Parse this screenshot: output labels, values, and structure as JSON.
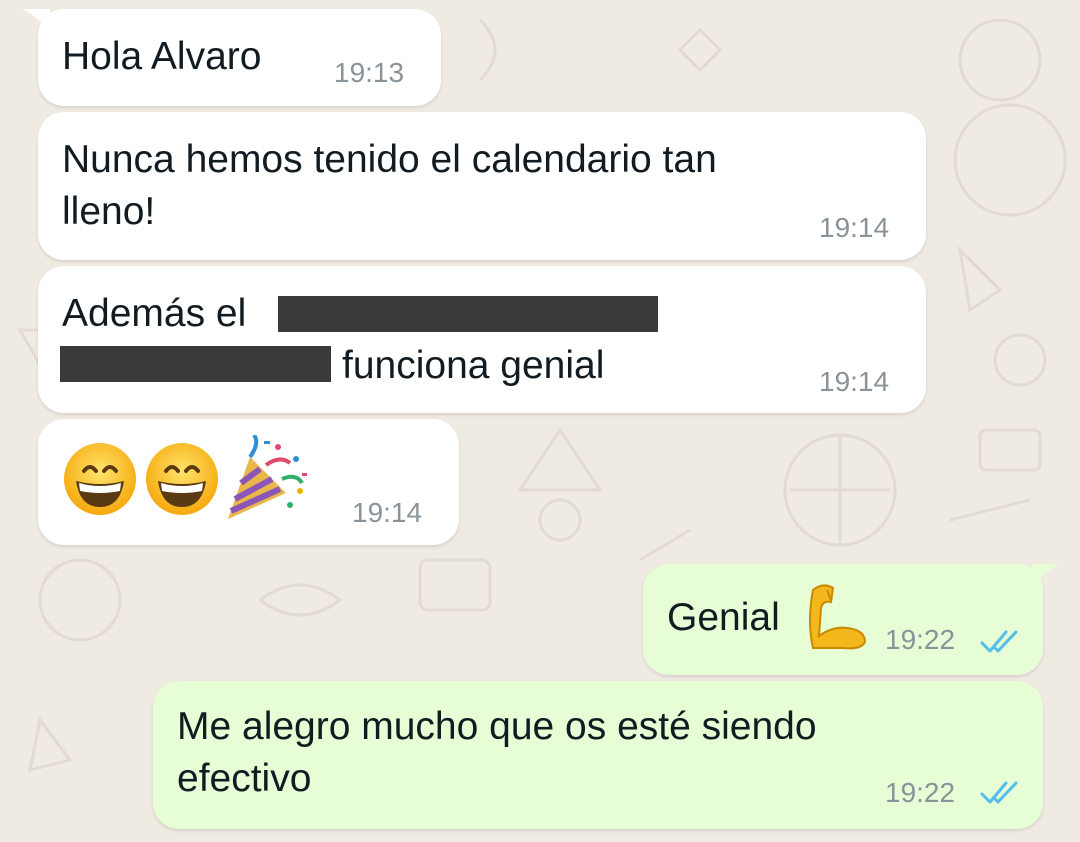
{
  "messages": [
    {
      "direction": "incoming",
      "text": "Hola Alvaro",
      "time": "19:13"
    },
    {
      "direction": "incoming",
      "text_lines": [
        "Nunca hemos tenido el calendario tan",
        "lleno!"
      ],
      "time": "19:14"
    },
    {
      "direction": "incoming",
      "text_parts": [
        "Además el",
        "funciona genial"
      ],
      "redacted": true,
      "time": "19:14"
    },
    {
      "direction": "incoming",
      "emojis": [
        "grinning-face-icon",
        "grinning-face-icon",
        "party-popper-icon"
      ],
      "time": "19:14"
    },
    {
      "direction": "outgoing",
      "text": "Genial",
      "emoji": "flexed-biceps-icon",
      "time": "19:22",
      "status": "read"
    },
    {
      "direction": "outgoing",
      "text_lines": [
        "Me alegro mucho que os esté siendo",
        "efectivo"
      ],
      "time": "19:22",
      "status": "read"
    }
  ],
  "colors": {
    "wallpaper": "#efeae2",
    "incoming_bubble": "#ffffff",
    "outgoing_bubble": "#e7fdd5",
    "timestamp": "#8a9399",
    "read_ticks": "#53bdeb",
    "redaction": "#3a3a3a"
  }
}
